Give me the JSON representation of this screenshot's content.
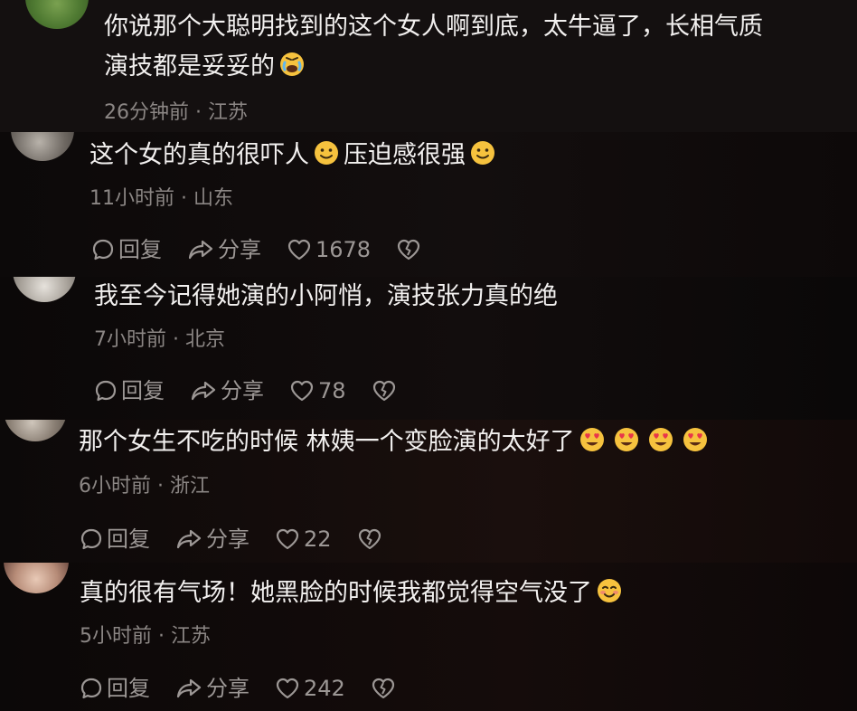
{
  "comments": [
    {
      "text_line1": "你说那个大聪明找到的这个女人啊到底，太牛逼了，长相气质",
      "text_line2": "演技都是妥妥的",
      "meta": "26分钟前 · 江苏",
      "emojis": [
        "sweat-cry-emoji"
      ]
    },
    {
      "text_part1": "这个女的真的很吓人",
      "text_part2": "压迫感很强",
      "meta": "11小时前 · 山东",
      "reply_label": "回复",
      "share_label": "分享",
      "likes": "1678",
      "emojis": [
        "smile-emoji",
        "smile-emoji"
      ]
    },
    {
      "text": "我至今记得她演的小阿悄，演技张力真的绝",
      "meta": "7小时前 · 北京",
      "reply_label": "回复",
      "share_label": "分享",
      "likes": "78"
    },
    {
      "text": "那个女生不吃的时候 林姨一个变脸演的太好了",
      "meta": "6小时前 · 浙江",
      "reply_label": "回复",
      "share_label": "分享",
      "likes": "22",
      "emojis": [
        "heart-eyes-emoji",
        "heart-eyes-emoji",
        "heart-eyes-emoji",
        "heart-eyes-emoji"
      ]
    },
    {
      "text": "真的很有气场！她黑脸的时候我都觉得空气没了",
      "meta": "5小时前 · 江苏",
      "reply_label": "回复",
      "share_label": "分享",
      "likes": "242",
      "emojis": [
        "blush-emoji"
      ]
    }
  ],
  "colors": {
    "primary_text": "#f2f0ef",
    "secondary_text": "#8b8684",
    "action_text": "#9c9795",
    "emoji_yellow": "#f6c23e"
  }
}
